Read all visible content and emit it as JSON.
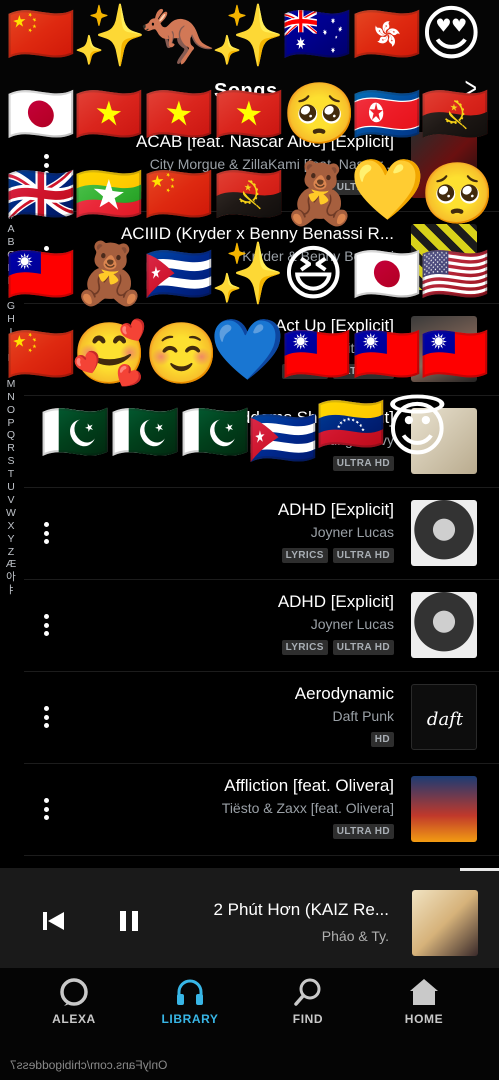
{
  "header": {
    "title": "Songs"
  },
  "alpha_index": [
    "#",
    "A",
    "B",
    "C",
    "D",
    "E",
    "F",
    "G",
    "H",
    "I",
    "J",
    "K",
    "L",
    "M",
    "N",
    "O",
    "P",
    "Q",
    "R",
    "S",
    "T",
    "U",
    "V",
    "W",
    "X",
    "Y",
    "Z",
    "Æ",
    "아",
    "ㅑ"
  ],
  "songs": [
    {
      "title": "ACAB [feat. Nascar Aloe] [Explicit]",
      "artist": "City Morgue & ZillaKami [feat. Nascar...",
      "badges": [
        "ULTRA HD"
      ]
    },
    {
      "title": "ACIIID (Kryder x Benny Benassi R...",
      "artist": "Kryder & Benny Benassi",
      "badges": [
        "HD"
      ]
    },
    {
      "title": "Act Up [Explicit]",
      "artist": "City Girls",
      "badges": [
        "ULTRA HD",
        "LYRICS"
      ]
    },
    {
      "title": "Addams Shit [Explicit]",
      "artist": "Yung Gravy",
      "badges": [
        "ULTRA HD"
      ]
    },
    {
      "title": "ADHD [Explicit]",
      "artist": "Joyner Lucas",
      "badges": [
        "ULTRA HD",
        "LYRICS"
      ]
    },
    {
      "title": "ADHD [Explicit]",
      "artist": "Joyner Lucas",
      "badges": [
        "ULTRA HD",
        "LYRICS"
      ]
    },
    {
      "title": "Aerodynamic",
      "artist": "Daft Punk",
      "badges": [
        "HD"
      ]
    },
    {
      "title": "Affliction [feat. Olivera]",
      "artist": "Tiësto & Zaxx [feat. Olivera]",
      "badges": [
        "ULTRA HD"
      ]
    }
  ],
  "now_playing": {
    "title": "2 Phút Hơn (KAIZ Re...",
    "artist": "Pháo & Ty."
  },
  "nav": {
    "home": "HOME",
    "find": "FIND",
    "library": "LIBRARY",
    "alexa": "ALEXA"
  },
  "watermark": "OnlyFans.com/chibigoddess7",
  "colors": {
    "accent": "#38b6e6",
    "background": "#000000",
    "player_bg": "#1a1a1a"
  },
  "stickers": [
    "🇨🇳",
    "✨",
    "🦘",
    "✨",
    "🇦🇺",
    "🇭🇰",
    "😍",
    "🇯🇵",
    "🇻🇳",
    "🇻🇳",
    "🇻🇳",
    "🥺",
    "🇰🇵",
    "🇦🇴",
    "🇬🇧",
    "🇲🇲",
    "🇨🇳",
    "🇦🇴",
    "🧸",
    "💛",
    "🥺",
    "🇹🇼",
    "🧸",
    "🇨🇺",
    "✨",
    "😆",
    "🇯🇵",
    "🇺🇸",
    "🇨🇳",
    "🥰",
    "☺️",
    "💙",
    "🇹🇼",
    "🇹🇼",
    "🇹🇼",
    "🇵🇰",
    "🇵🇰",
    "🇵🇰",
    "🇨🇺",
    "🇻🇪",
    "😇"
  ]
}
